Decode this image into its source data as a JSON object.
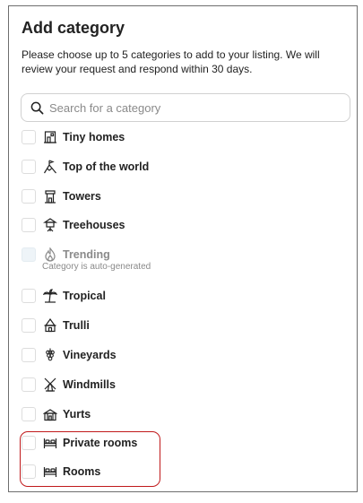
{
  "dialog": {
    "title": "Add category",
    "description": "Please choose up to 5 categories to add to your listing. We will review your request and respond within 30 days."
  },
  "search": {
    "placeholder": "Search for a category",
    "value": ""
  },
  "categories": [
    {
      "label": "Tiny homes",
      "icon": "tiny-home-icon",
      "checked": false,
      "disabled": false
    },
    {
      "label": "Top of the world",
      "icon": "mountain-summit-icon",
      "checked": false,
      "disabled": false
    },
    {
      "label": "Towers",
      "icon": "tower-icon",
      "checked": false,
      "disabled": false
    },
    {
      "label": "Treehouses",
      "icon": "treehouse-icon",
      "checked": false,
      "disabled": false
    },
    {
      "label": "Trending",
      "icon": "flame-icon",
      "checked": false,
      "disabled": true,
      "note": "Category is auto-generated"
    },
    {
      "label": "Tropical",
      "icon": "palm-tree-icon",
      "checked": false,
      "disabled": false
    },
    {
      "label": "Trulli",
      "icon": "trullo-icon",
      "checked": false,
      "disabled": false
    },
    {
      "label": "Vineyards",
      "icon": "grapes-icon",
      "checked": false,
      "disabled": false
    },
    {
      "label": "Windmills",
      "icon": "windmill-icon",
      "checked": false,
      "disabled": false
    },
    {
      "label": "Yurts",
      "icon": "yurt-icon",
      "checked": false,
      "disabled": false
    },
    {
      "label": "Private rooms",
      "icon": "bed-icon",
      "checked": false,
      "disabled": false
    },
    {
      "label": "Rooms",
      "icon": "bed-icon",
      "checked": false,
      "disabled": false
    }
  ],
  "colors": {
    "highlight": "#c0191b",
    "text": "#222222",
    "muted": "#8a8a8a"
  }
}
